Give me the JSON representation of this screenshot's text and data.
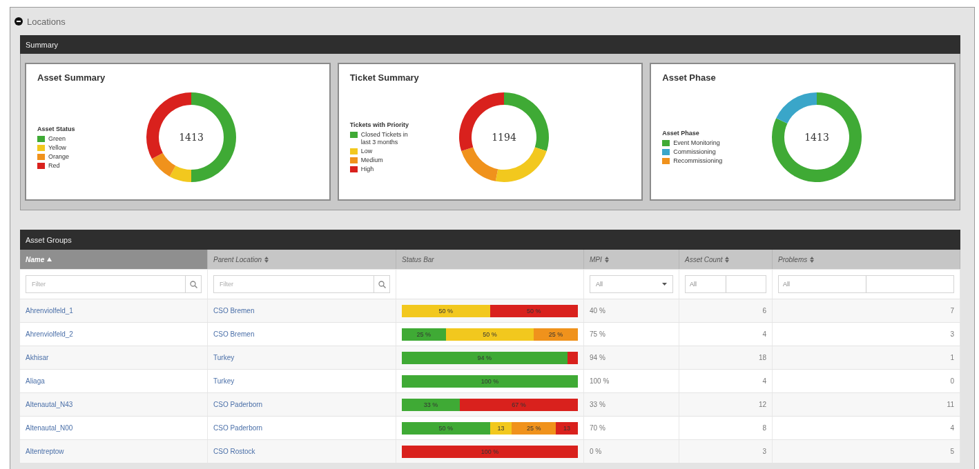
{
  "page": {
    "title": "Locations",
    "expanded": true
  },
  "summary": {
    "title": "Summary",
    "cards": [
      {
        "title": "Asset Summary",
        "legend_title": "Asset Status",
        "total": "1413",
        "legend": [
          {
            "label": "Green",
            "color": "#3faa35"
          },
          {
            "label": "Yellow",
            "color": "#f2c81e"
          },
          {
            "label": "Orange",
            "color": "#f0921c"
          },
          {
            "label": "Red",
            "color": "#d9211d"
          }
        ]
      },
      {
        "title": "Ticket Summary",
        "legend_title": "Tickets with Priority",
        "total": "1194",
        "legend": [
          {
            "label": "Closed Tickets in last 3 months",
            "color": "#3faa35"
          },
          {
            "label": "Low",
            "color": "#f2c81e"
          },
          {
            "label": "Medium",
            "color": "#f0921c"
          },
          {
            "label": "High",
            "color": "#d9211d"
          }
        ]
      },
      {
        "title": "Asset Phase",
        "legend_title": "Asset Phase",
        "total": "1413",
        "legend": [
          {
            "label": "Event Monitoring",
            "color": "#3faa35"
          },
          {
            "label": "Commissioning",
            "color": "#3aa6c9"
          },
          {
            "label": "Recommissioning",
            "color": "#f0921c"
          }
        ]
      }
    ]
  },
  "asset_groups": {
    "title": "Asset Groups",
    "columns": [
      {
        "label": "Name",
        "sorted": true,
        "filter": {
          "kind": "search",
          "placeholder": "Filter"
        }
      },
      {
        "label": "Parent Location",
        "sorted": false,
        "filter": {
          "kind": "search",
          "placeholder": "Filter"
        }
      },
      {
        "label": "Status Bar",
        "sortable": false,
        "sorted": false,
        "filter": {
          "kind": "none"
        }
      },
      {
        "label": "MPI",
        "sorted": false,
        "filter": {
          "kind": "select",
          "value": "All"
        }
      },
      {
        "label": "Asset Count",
        "sorted": false,
        "filter": {
          "kind": "range",
          "value": "All"
        }
      },
      {
        "label": "Problems",
        "sorted": false,
        "filter": {
          "kind": "range",
          "value": "All"
        }
      }
    ],
    "rows": [
      {
        "name": "Ahrenviolfeld_1",
        "parent": "CSO Bremen",
        "status": [
          {
            "color": "#f2c81e",
            "label": "50 %"
          },
          {
            "color": "#d9211d",
            "label": "50 %"
          }
        ],
        "mpi": "40 %",
        "asset_count": "6",
        "problems": "7"
      },
      {
        "name": "Ahrenviolfeld_2",
        "parent": "CSO Bremen",
        "status": [
          {
            "color": "#3faa35",
            "label": "25 %"
          },
          {
            "color": "#f2c81e",
            "label": "50 %"
          },
          {
            "color": "#f0921c",
            "label": "25 %"
          }
        ],
        "mpi": "75 %",
        "asset_count": "4",
        "problems": "3"
      },
      {
        "name": "Akhisar",
        "parent": "Turkey",
        "status": [
          {
            "color": "#3faa35",
            "label": "94 %"
          },
          {
            "color": "#d9211d"
          }
        ],
        "mpi": "94 %",
        "asset_count": "18",
        "problems": "1"
      },
      {
        "name": "Aliaga",
        "parent": "Turkey",
        "status": [
          {
            "color": "#3faa35",
            "label": "100 %"
          }
        ],
        "mpi": "100 %",
        "asset_count": "4",
        "problems": "0"
      },
      {
        "name": "Altenautal_N43",
        "parent": "CSO Paderborn",
        "status": [
          {
            "color": "#3faa35",
            "label": "33 %"
          },
          {
            "color": "#d9211d",
            "label": "67 %"
          }
        ],
        "mpi": "33 %",
        "asset_count": "12",
        "problems": "11"
      },
      {
        "name": "Altenautal_N00",
        "parent": "CSO Paderborn",
        "status": [
          {
            "color": "#3faa35",
            "label": "50 %"
          },
          {
            "color": "#f2c81e",
            "label": "13"
          },
          {
            "color": "#f0921c",
            "label": "25 %"
          },
          {
            "color": "#d9211d",
            "label": "13"
          }
        ],
        "mpi": "70 %",
        "asset_count": "8",
        "problems": "4"
      },
      {
        "name": "Altentreptow",
        "parent": "CSO Rostock",
        "status": [
          {
            "color": "#d9211d",
            "label": "100 %"
          }
        ],
        "mpi": "0 %",
        "asset_count": "3",
        "problems": "5"
      }
    ]
  }
}
